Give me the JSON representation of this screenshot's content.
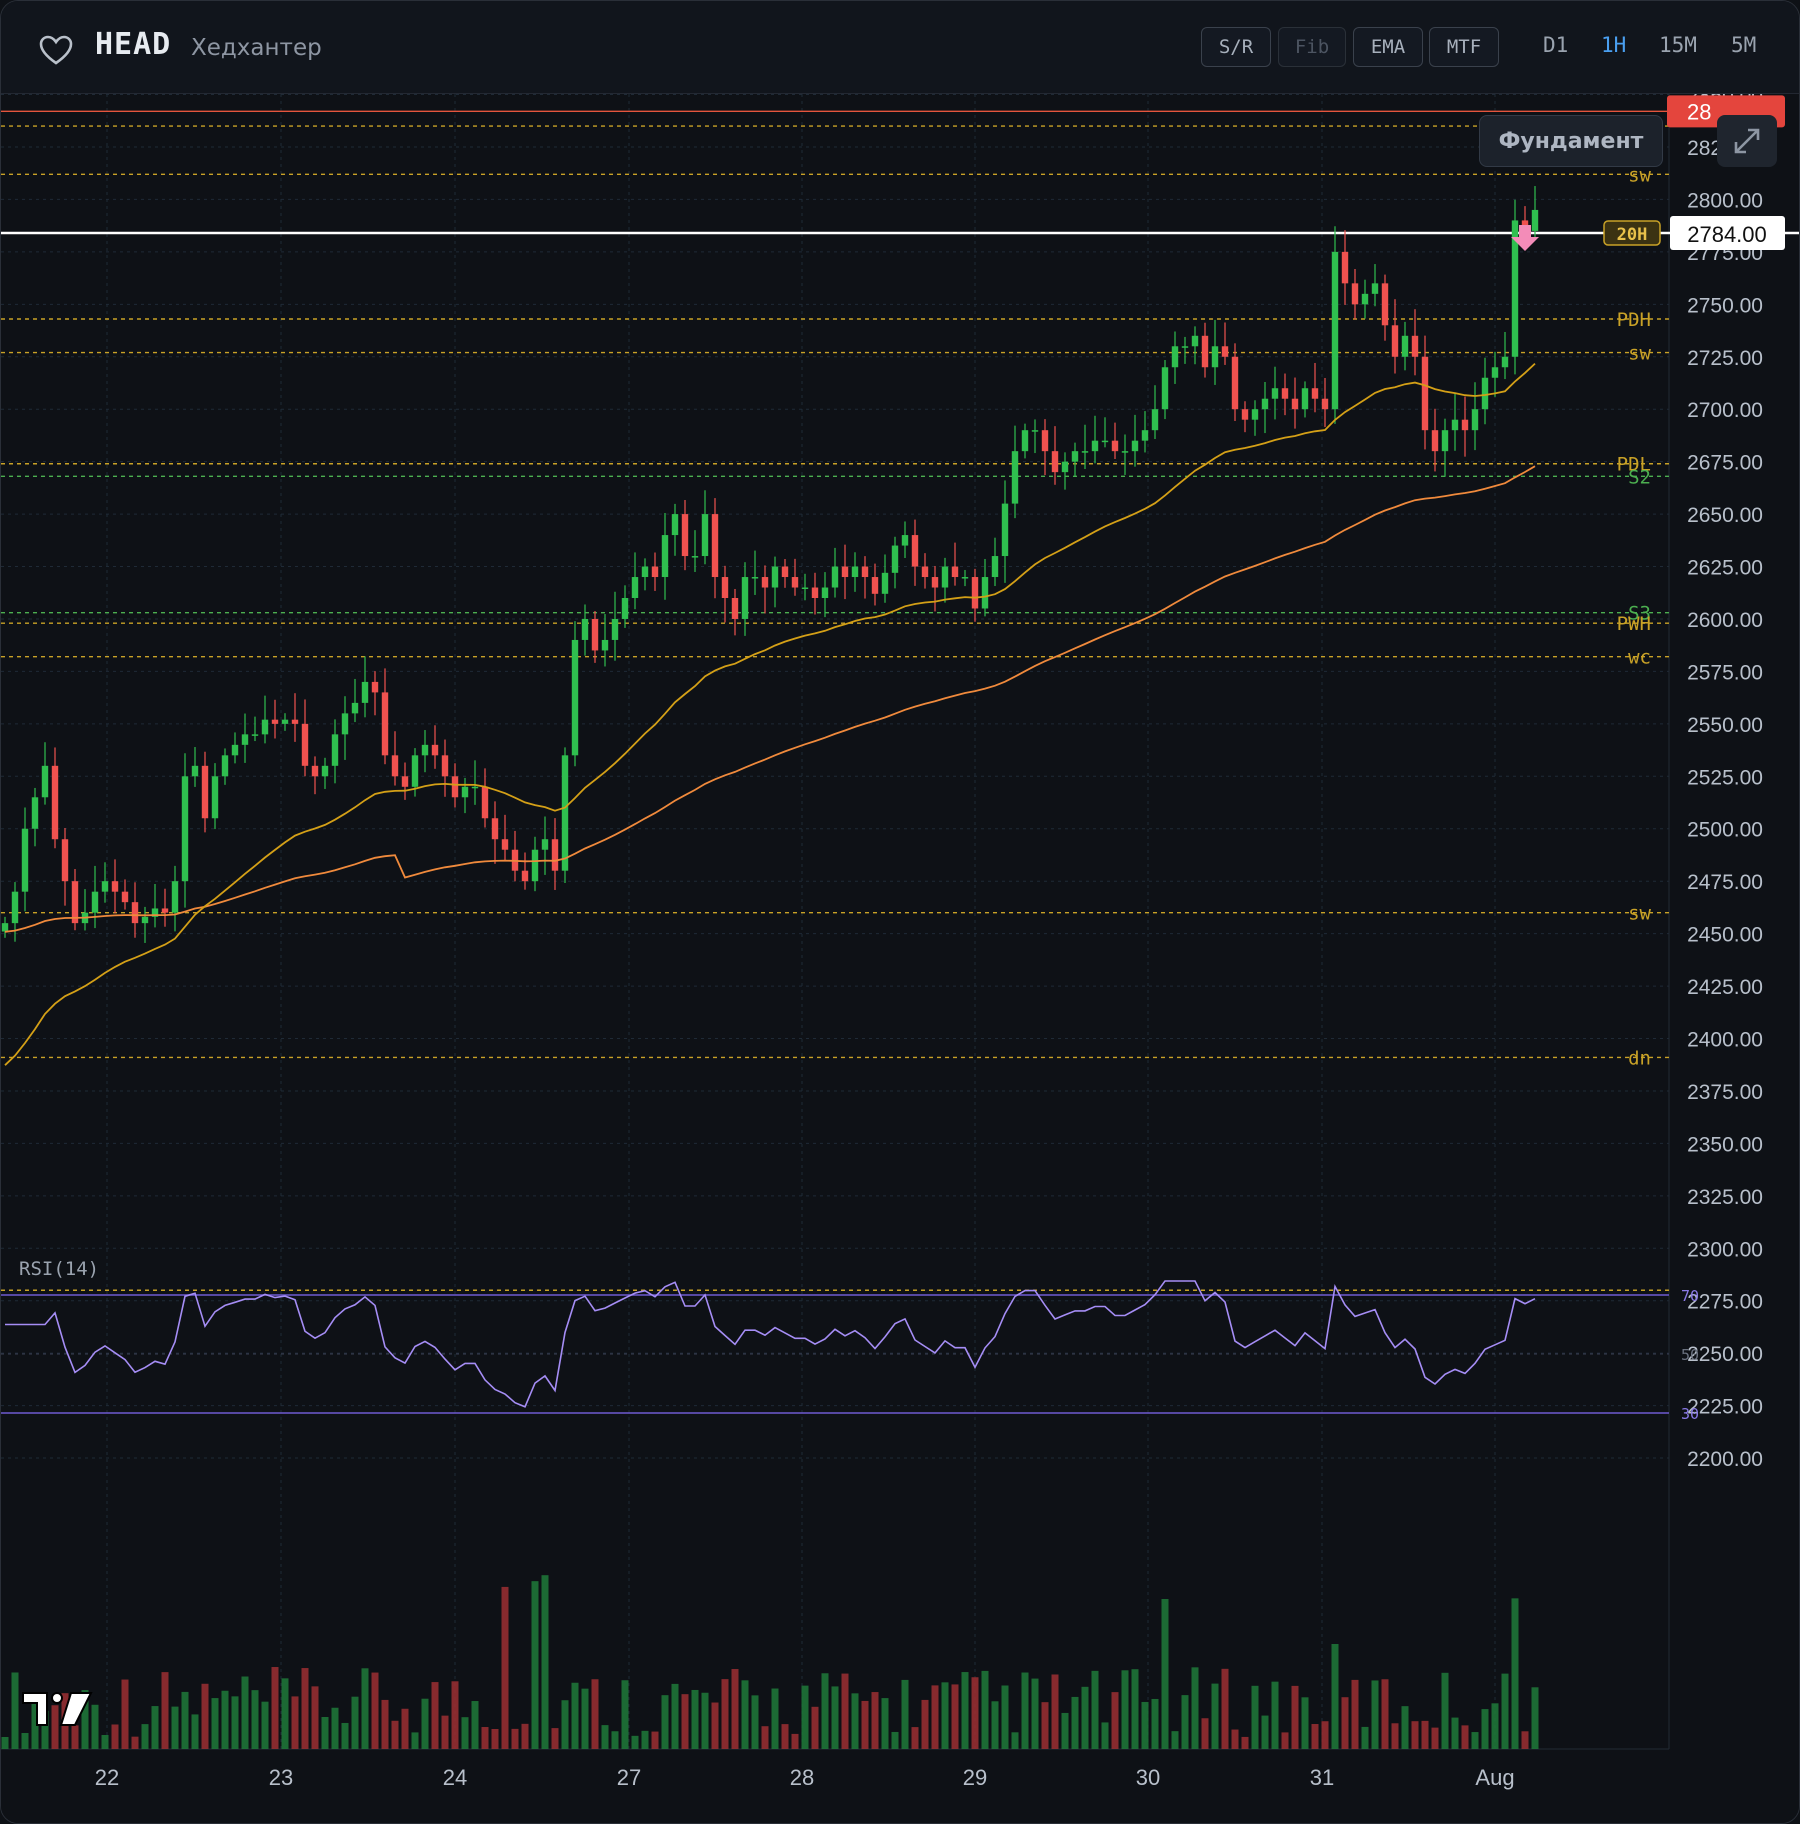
{
  "header": {
    "symbol": "HEAD",
    "owner": "Хедхантер",
    "tools": [
      "S/R",
      "Fib",
      "EMA",
      "MTF"
    ],
    "timeframes": [
      "D1",
      "1H",
      "15M",
      "5M"
    ],
    "active_timeframe": "1H"
  },
  "overlay": {
    "fundament_label": "Фундамент",
    "top_price_tag": "28"
  },
  "price_axis": {
    "ticks": [
      "2850.00",
      "2825.00",
      "2800.00",
      "2775.00",
      "2750.00",
      "2725.00",
      "2700.00",
      "2675.00",
      "2650.00",
      "2625.00",
      "2600.00",
      "2575.00",
      "2550.00",
      "2525.00",
      "2500.00",
      "2475.00",
      "2450.00",
      "2425.00",
      "2400.00",
      "2375.00",
      "2350.00",
      "2325.00",
      "2300.00",
      "2275.00",
      "2250.00",
      "2225.00",
      "2200.00"
    ],
    "current_price": "2784.00"
  },
  "time_axis": [
    "22",
    "23",
    "24",
    "27",
    "28",
    "29",
    "30",
    "31",
    "Aug"
  ],
  "levels": [
    {
      "label": "",
      "price": 2842,
      "color": "#e4553d",
      "style": "solid"
    },
    {
      "label": "",
      "price": 2835,
      "color": "#c9a227",
      "style": "dash"
    },
    {
      "label": "sw",
      "price": 2812,
      "color": "#c9a227",
      "style": "dash"
    },
    {
      "label": "20H",
      "price": 2784,
      "color": "#ffffff",
      "style": "solid"
    },
    {
      "label": "PDH",
      "price": 2743,
      "color": "#c9a227",
      "style": "dash"
    },
    {
      "label": "sw",
      "price": 2727,
      "color": "#c9a227",
      "style": "dash"
    },
    {
      "label": "PDL",
      "price": 2674,
      "color": "#c9a227",
      "style": "dash"
    },
    {
      "label": "S2",
      "price": 2668,
      "color": "#4caf50",
      "style": "dash"
    },
    {
      "label": "S3",
      "price": 2603,
      "color": "#4caf50",
      "style": "dash"
    },
    {
      "label": "PWH",
      "price": 2598,
      "color": "#c9a227",
      "style": "dash"
    },
    {
      "label": "wc",
      "price": 2582,
      "color": "#c9a227",
      "style": "dash"
    },
    {
      "label": "sw",
      "price": 2460,
      "color": "#c9a227",
      "style": "dash"
    },
    {
      "label": "dn",
      "price": 2391,
      "color": "#c9a227",
      "style": "dash"
    },
    {
      "label": "",
      "price": 2280,
      "color": "#c9a227",
      "style": "dash"
    }
  ],
  "rsi": {
    "label": "RSI(14)",
    "levels": [
      "70",
      "50",
      "30"
    ]
  },
  "chart_data": {
    "type": "candlestick",
    "y_range": [
      2190,
      2858
    ],
    "volume_range": [
      0,
      100
    ],
    "day_labels": [
      "22",
      "23",
      "24",
      "27",
      "28",
      "29",
      "30",
      "31",
      "Aug"
    ],
    "close_points": [
      [
        0,
        2455
      ],
      [
        1,
        2470
      ],
      [
        2,
        2500
      ],
      [
        3,
        2515
      ],
      [
        4,
        2530
      ],
      [
        5,
        2495
      ],
      [
        6,
        2475
      ],
      [
        7,
        2455
      ],
      [
        8,
        2460
      ],
      [
        9,
        2470
      ],
      [
        10,
        2475
      ],
      [
        11,
        2470
      ],
      [
        12,
        2465
      ],
      [
        13,
        2455
      ],
      [
        14,
        2458
      ],
      [
        15,
        2462
      ],
      [
        16,
        2460
      ],
      [
        17,
        2475
      ],
      [
        18,
        2525
      ],
      [
        19,
        2530
      ],
      [
        20,
        2505
      ],
      [
        21,
        2525
      ],
      [
        22,
        2535
      ],
      [
        23,
        2540
      ],
      [
        24,
        2545
      ],
      [
        25,
        2545
      ],
      [
        26,
        2552
      ],
      [
        27,
        2550
      ],
      [
        28,
        2552
      ],
      [
        29,
        2550
      ],
      [
        30,
        2530
      ],
      [
        31,
        2525
      ],
      [
        32,
        2530
      ],
      [
        33,
        2545
      ],
      [
        34,
        2555
      ],
      [
        35,
        2560
      ],
      [
        36,
        2570
      ],
      [
        37,
        2565
      ],
      [
        38,
        2535
      ],
      [
        39,
        2525
      ],
      [
        40,
        2520
      ],
      [
        41,
        2535
      ],
      [
        42,
        2540
      ],
      [
        43,
        2535
      ],
      [
        44,
        2525
      ],
      [
        45,
        2515
      ],
      [
        46,
        2520
      ],
      [
        47,
        2520
      ],
      [
        48,
        2505
      ],
      [
        49,
        2495
      ],
      [
        50,
        2490
      ],
      [
        51,
        2480
      ],
      [
        52,
        2475
      ],
      [
        53,
        2490
      ],
      [
        54,
        2495
      ],
      [
        55,
        2480
      ],
      [
        56,
        2535
      ],
      [
        57,
        2590
      ],
      [
        58,
        2600
      ],
      [
        59,
        2585
      ],
      [
        60,
        2590
      ],
      [
        61,
        2600
      ],
      [
        62,
        2610
      ],
      [
        63,
        2620
      ],
      [
        64,
        2625
      ],
      [
        65,
        2620
      ],
      [
        66,
        2640
      ],
      [
        67,
        2650
      ],
      [
        68,
        2630
      ],
      [
        69,
        2630
      ],
      [
        70,
        2650
      ],
      [
        71,
        2620
      ],
      [
        72,
        2610
      ],
      [
        73,
        2600
      ],
      [
        74,
        2620
      ],
      [
        75,
        2620
      ],
      [
        76,
        2615
      ],
      [
        77,
        2625
      ],
      [
        78,
        2620
      ],
      [
        79,
        2615
      ],
      [
        80,
        2615
      ],
      [
        81,
        2610
      ],
      [
        82,
        2615
      ],
      [
        83,
        2625
      ],
      [
        84,
        2620
      ],
      [
        85,
        2625
      ],
      [
        86,
        2620
      ],
      [
        87,
        2612
      ],
      [
        88,
        2622
      ],
      [
        89,
        2635
      ],
      [
        90,
        2640
      ],
      [
        91,
        2625
      ],
      [
        92,
        2620
      ],
      [
        93,
        2615
      ],
      [
        94,
        2625
      ],
      [
        95,
        2620
      ],
      [
        96,
        2620
      ],
      [
        97,
        2605
      ],
      [
        98,
        2620
      ],
      [
        99,
        2630
      ],
      [
        100,
        2655
      ],
      [
        101,
        2680
      ],
      [
        102,
        2690
      ],
      [
        103,
        2690
      ],
      [
        104,
        2680
      ],
      [
        105,
        2670
      ],
      [
        106,
        2675
      ],
      [
        107,
        2680
      ],
      [
        108,
        2680
      ],
      [
        109,
        2685
      ],
      [
        110,
        2685
      ],
      [
        111,
        2680
      ],
      [
        112,
        2680
      ],
      [
        113,
        2685
      ],
      [
        114,
        2690
      ],
      [
        115,
        2700
      ],
      [
        116,
        2720
      ],
      [
        117,
        2730
      ],
      [
        118,
        2730
      ],
      [
        119,
        2735
      ],
      [
        120,
        2720
      ],
      [
        121,
        2730
      ],
      [
        122,
        2725
      ],
      [
        123,
        2700
      ],
      [
        124,
        2695
      ],
      [
        125,
        2700
      ],
      [
        126,
        2705
      ],
      [
        127,
        2710
      ],
      [
        128,
        2705
      ],
      [
        129,
        2700
      ],
      [
        130,
        2710
      ],
      [
        131,
        2705
      ],
      [
        132,
        2700
      ],
      [
        133,
        2775
      ],
      [
        134,
        2760
      ],
      [
        135,
        2750
      ],
      [
        136,
        2755
      ],
      [
        137,
        2760
      ],
      [
        138,
        2740
      ],
      [
        139,
        2725
      ],
      [
        140,
        2735
      ],
      [
        141,
        2725
      ],
      [
        142,
        2690
      ],
      [
        143,
        2680
      ],
      [
        144,
        2690
      ],
      [
        145,
        2695
      ],
      [
        146,
        2690
      ],
      [
        147,
        2700
      ],
      [
        148,
        2715
      ],
      [
        149,
        2720
      ],
      [
        150,
        2725
      ],
      [
        151,
        2790
      ],
      [
        152,
        2785
      ],
      [
        153,
        2795
      ]
    ],
    "series": [
      {
        "name": "EMA 50",
        "color": "#d4a017"
      },
      {
        "name": "EMA 200",
        "color": "#f08a3c"
      }
    ],
    "volume_note": "green = up bar, red = down bar"
  }
}
